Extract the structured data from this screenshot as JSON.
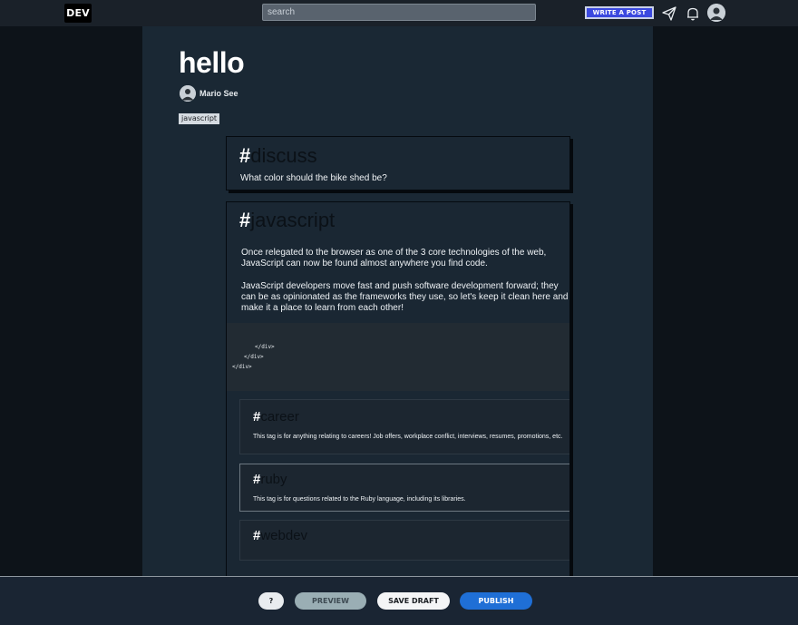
{
  "nav": {
    "logo": "DEV",
    "search_placeholder": "search",
    "write_post": "WRITE A POST",
    "icons": [
      "paper-plane-icon",
      "bell-icon",
      "avatar"
    ]
  },
  "post": {
    "title": "hello",
    "author": "Mario See",
    "tag": "javascript"
  },
  "tag_cards": {
    "discuss": {
      "hash": "#",
      "name": "discuss",
      "description": "What color should the bike shed be?"
    },
    "javascript": {
      "hash": "#",
      "name": "javascript",
      "paragraph1": "Once relegated to the browser as one of the 3 core technologies of the web, JavaScript can now be found almost anywhere you find code.",
      "paragraph2": "JavaScript developers move fast and push software development forward; they can be as opinionated as the frameworks they use, so let's keep it clean here and make it a place to learn from each other!",
      "code_lines": [
        "</div>",
        "</div>",
        "</div>"
      ]
    },
    "career": {
      "hash": "#",
      "name": "career",
      "description": "This tag is for anything relating to careers! Job offers, workplace conflict, interviews, resumes, promotions, etc."
    },
    "ruby": {
      "hash": "#",
      "name": "ruby",
      "description": "This tag is for questions related to the Ruby language, including its libraries."
    },
    "webdev": {
      "hash": "#",
      "name": "webdev"
    }
  },
  "actions": {
    "help": "?",
    "preview": "PREVIEW",
    "save_draft": "SAVE DRAFT",
    "publish": "PUBLISH"
  },
  "colors": {
    "background": "#0d1219",
    "main_panel": "#1a2834",
    "publish": "#1f6fd6",
    "write_button": "#3b49df"
  }
}
